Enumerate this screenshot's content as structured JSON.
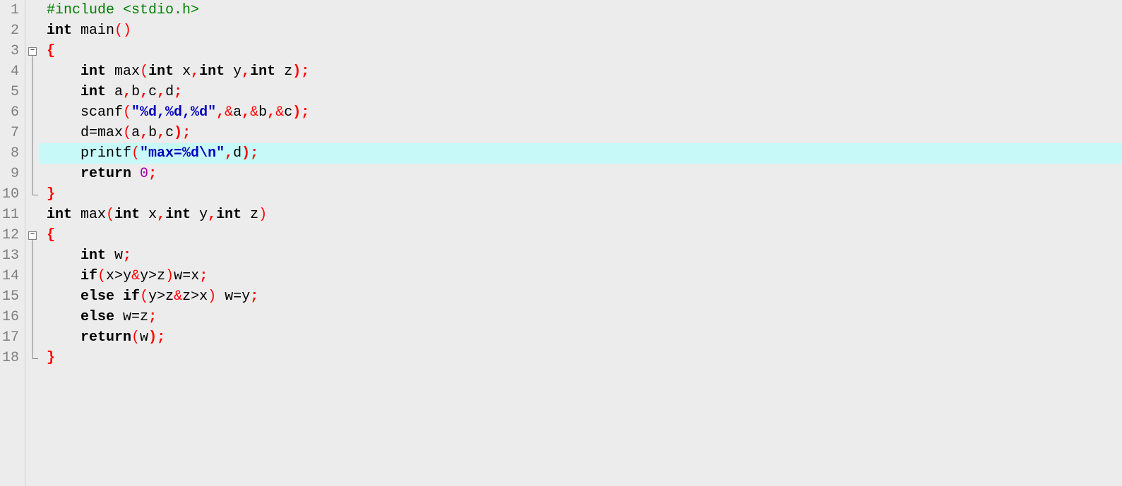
{
  "editor": {
    "highlight_line": 8,
    "fold_marks": {
      "3": "box-start",
      "4": "line",
      "5": "line",
      "6": "line",
      "7": "line",
      "8": "line",
      "9": "line",
      "10": "end",
      "12": "box-start",
      "13": "line",
      "14": "line",
      "15": "line",
      "16": "line",
      "17": "line",
      "18": "end"
    },
    "lines": [
      {
        "n": 1,
        "tokens": [
          {
            "t": "#include <stdio.h>",
            "c": "pre"
          }
        ]
      },
      {
        "n": 2,
        "tokens": [
          {
            "t": "int",
            "c": "kw"
          },
          {
            "t": " ",
            "c": "plain"
          },
          {
            "t": "main",
            "c": "ident"
          },
          {
            "t": "()",
            "c": "paren"
          }
        ]
      },
      {
        "n": 3,
        "tokens": [
          {
            "t": "{",
            "c": "brace"
          }
        ]
      },
      {
        "n": 4,
        "tokens": [
          {
            "t": "    ",
            "c": "plain"
          },
          {
            "t": "int",
            "c": "kw"
          },
          {
            "t": " ",
            "c": "plain"
          },
          {
            "t": "max",
            "c": "ident"
          },
          {
            "t": "(",
            "c": "paren"
          },
          {
            "t": "int",
            "c": "kw"
          },
          {
            "t": " x",
            "c": "ident"
          },
          {
            "t": ",",
            "c": "punc"
          },
          {
            "t": "int",
            "c": "kw"
          },
          {
            "t": " y",
            "c": "ident"
          },
          {
            "t": ",",
            "c": "punc"
          },
          {
            "t": "int",
            "c": "kw"
          },
          {
            "t": " z",
            "c": "ident"
          },
          {
            "t": ");",
            "c": "punc"
          }
        ]
      },
      {
        "n": 5,
        "tokens": [
          {
            "t": "    ",
            "c": "plain"
          },
          {
            "t": "int",
            "c": "kw"
          },
          {
            "t": " a",
            "c": "ident"
          },
          {
            "t": ",",
            "c": "punc"
          },
          {
            "t": "b",
            "c": "ident"
          },
          {
            "t": ",",
            "c": "punc"
          },
          {
            "t": "c",
            "c": "ident"
          },
          {
            "t": ",",
            "c": "punc"
          },
          {
            "t": "d",
            "c": "ident"
          },
          {
            "t": ";",
            "c": "punc"
          }
        ]
      },
      {
        "n": 6,
        "tokens": [
          {
            "t": "    ",
            "c": "plain"
          },
          {
            "t": "scanf",
            "c": "ident"
          },
          {
            "t": "(",
            "c": "paren"
          },
          {
            "t": "\"%d,%d,%d\"",
            "c": "str"
          },
          {
            "t": ",",
            "c": "punc"
          },
          {
            "t": "&",
            "c": "amp"
          },
          {
            "t": "a",
            "c": "ident"
          },
          {
            "t": ",",
            "c": "punc"
          },
          {
            "t": "&",
            "c": "amp"
          },
          {
            "t": "b",
            "c": "ident"
          },
          {
            "t": ",",
            "c": "punc"
          },
          {
            "t": "&",
            "c": "amp"
          },
          {
            "t": "c",
            "c": "ident"
          },
          {
            "t": ");",
            "c": "punc"
          }
        ]
      },
      {
        "n": 7,
        "tokens": [
          {
            "t": "    ",
            "c": "plain"
          },
          {
            "t": "d",
            "c": "ident"
          },
          {
            "t": "=",
            "c": "op"
          },
          {
            "t": "max",
            "c": "ident"
          },
          {
            "t": "(",
            "c": "paren"
          },
          {
            "t": "a",
            "c": "ident"
          },
          {
            "t": ",",
            "c": "punc"
          },
          {
            "t": "b",
            "c": "ident"
          },
          {
            "t": ",",
            "c": "punc"
          },
          {
            "t": "c",
            "c": "ident"
          },
          {
            "t": ");",
            "c": "punc"
          }
        ]
      },
      {
        "n": 8,
        "tokens": [
          {
            "t": "    ",
            "c": "plain"
          },
          {
            "t": "printf",
            "c": "ident"
          },
          {
            "t": "(",
            "c": "paren"
          },
          {
            "t": "\"max=%d\\n\"",
            "c": "str"
          },
          {
            "t": ",",
            "c": "punc"
          },
          {
            "t": "d",
            "c": "ident"
          },
          {
            "t": ");",
            "c": "punc"
          }
        ]
      },
      {
        "n": 9,
        "tokens": [
          {
            "t": "    ",
            "c": "plain"
          },
          {
            "t": "return",
            "c": "kw"
          },
          {
            "t": " ",
            "c": "plain"
          },
          {
            "t": "0",
            "c": "num"
          },
          {
            "t": ";",
            "c": "punc"
          }
        ]
      },
      {
        "n": 10,
        "tokens": [
          {
            "t": "}",
            "c": "brace"
          }
        ]
      },
      {
        "n": 11,
        "tokens": [
          {
            "t": "int",
            "c": "kw"
          },
          {
            "t": " ",
            "c": "plain"
          },
          {
            "t": "max",
            "c": "ident"
          },
          {
            "t": "(",
            "c": "paren"
          },
          {
            "t": "int",
            "c": "kw"
          },
          {
            "t": " x",
            "c": "ident"
          },
          {
            "t": ",",
            "c": "punc"
          },
          {
            "t": "int",
            "c": "kw"
          },
          {
            "t": " y",
            "c": "ident"
          },
          {
            "t": ",",
            "c": "punc"
          },
          {
            "t": "int",
            "c": "kw"
          },
          {
            "t": " z",
            "c": "ident"
          },
          {
            "t": ")",
            "c": "paren"
          }
        ]
      },
      {
        "n": 12,
        "tokens": [
          {
            "t": "{",
            "c": "brace"
          }
        ]
      },
      {
        "n": 13,
        "tokens": [
          {
            "t": "    ",
            "c": "plain"
          },
          {
            "t": "int",
            "c": "kw"
          },
          {
            "t": " w",
            "c": "ident"
          },
          {
            "t": ";",
            "c": "punc"
          }
        ]
      },
      {
        "n": 14,
        "tokens": [
          {
            "t": "    ",
            "c": "plain"
          },
          {
            "t": "if",
            "c": "kw"
          },
          {
            "t": "(",
            "c": "paren"
          },
          {
            "t": "x",
            "c": "ident"
          },
          {
            "t": ">",
            "c": "op"
          },
          {
            "t": "y",
            "c": "ident"
          },
          {
            "t": "&",
            "c": "amp"
          },
          {
            "t": "y",
            "c": "ident"
          },
          {
            "t": ">",
            "c": "op"
          },
          {
            "t": "z",
            "c": "ident"
          },
          {
            "t": ")",
            "c": "paren"
          },
          {
            "t": "w",
            "c": "ident"
          },
          {
            "t": "=",
            "c": "op"
          },
          {
            "t": "x",
            "c": "ident"
          },
          {
            "t": ";",
            "c": "punc"
          }
        ]
      },
      {
        "n": 15,
        "tokens": [
          {
            "t": "    ",
            "c": "plain"
          },
          {
            "t": "else",
            "c": "kw"
          },
          {
            "t": " ",
            "c": "plain"
          },
          {
            "t": "if",
            "c": "kw"
          },
          {
            "t": "(",
            "c": "paren"
          },
          {
            "t": "y",
            "c": "ident"
          },
          {
            "t": ">",
            "c": "op"
          },
          {
            "t": "z",
            "c": "ident"
          },
          {
            "t": "&",
            "c": "amp"
          },
          {
            "t": "z",
            "c": "ident"
          },
          {
            "t": ">",
            "c": "op"
          },
          {
            "t": "x",
            "c": "ident"
          },
          {
            "t": ")",
            "c": "paren"
          },
          {
            "t": " w",
            "c": "ident"
          },
          {
            "t": "=",
            "c": "op"
          },
          {
            "t": "y",
            "c": "ident"
          },
          {
            "t": ";",
            "c": "punc"
          }
        ]
      },
      {
        "n": 16,
        "tokens": [
          {
            "t": "    ",
            "c": "plain"
          },
          {
            "t": "else",
            "c": "kw"
          },
          {
            "t": " w",
            "c": "ident"
          },
          {
            "t": "=",
            "c": "op"
          },
          {
            "t": "z",
            "c": "ident"
          },
          {
            "t": ";",
            "c": "punc"
          }
        ]
      },
      {
        "n": 17,
        "tokens": [
          {
            "t": "    ",
            "c": "plain"
          },
          {
            "t": "return",
            "c": "kw"
          },
          {
            "t": "(",
            "c": "paren"
          },
          {
            "t": "w",
            "c": "ident"
          },
          {
            "t": ");",
            "c": "punc"
          }
        ]
      },
      {
        "n": 18,
        "tokens": [
          {
            "t": "}",
            "c": "brace"
          }
        ]
      }
    ]
  }
}
